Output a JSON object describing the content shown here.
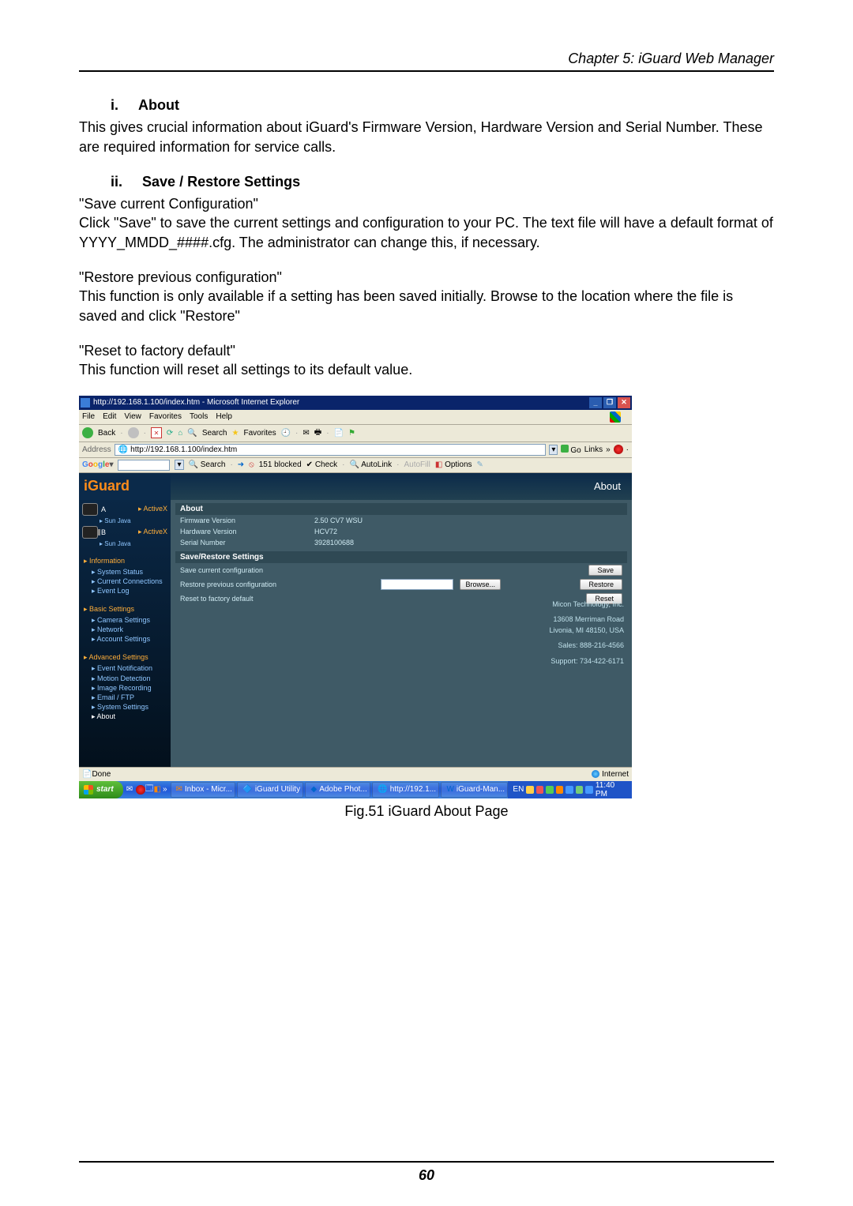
{
  "doc": {
    "chapter": "Chapter 5: iGuard Web Manager",
    "sec1_num": "i.",
    "sec1_title": "About",
    "sec1_p": "This gives crucial information about iGuard's Firmware Version, Hardware Version and Serial Number.    These are required information for service calls.",
    "sec2_num": "ii.",
    "sec2_title": "Save / Restore Settings",
    "sec2_l1": "\"Save current Configuration\"",
    "sec2_p1": "Click \"Save\" to save the current settings and configuration to your PC.    The text file will have a default format of YYYY_MMDD_####.cfg.    The administrator can change this, if necessary.",
    "sec2_l2": "\"Restore previous configuration\"",
    "sec2_p2": "This function is only available if a setting has been saved initially.    Browse to the location where the file is saved and click \"Restore\"",
    "sec2_l3": "\"Reset to factory default\"",
    "sec2_p3": "This function will reset all settings to its default value.",
    "caption": "Fig.51  iGuard About Page",
    "page_number": "60"
  },
  "shot": {
    "title": "http://192.168.1.100/index.htm - Microsoft Internet Explorer",
    "menu": {
      "file": "File",
      "edit": "Edit",
      "view": "View",
      "fav": "Favorites",
      "tools": "Tools",
      "help": "Help"
    },
    "toolbar": {
      "back": "Back",
      "search": "Search",
      "favorites": "Favorites"
    },
    "address_label": "Address",
    "address_value": "http://192.168.1.100/index.htm",
    "go": "Go",
    "links": "Links",
    "google": {
      "search": "Search",
      "blocked": "151 blocked",
      "check": "Check",
      "autolink": "AutoLink",
      "autofill": "AutoFill",
      "options": "Options"
    },
    "logo": "iGuard",
    "page_tab": "About",
    "sidebar": {
      "cam_a": "ActiveX",
      "cam_a_sub": "Sun Java",
      "cam_b": "ActiveX",
      "cam_b_sub": "Sun Java",
      "info_hdr": "Information",
      "info_items": [
        "System Status",
        "Current Connections",
        "Event Log"
      ],
      "basic_hdr": "Basic Settings",
      "basic_items": [
        "Camera Settings",
        "Network",
        "Account Settings"
      ],
      "adv_hdr": "Advanced Settings",
      "adv_items": [
        "Event Notification",
        "Motion Detection",
        "Image Recording",
        "Email / FTP",
        "System Settings",
        "About"
      ]
    },
    "about_panel": "About",
    "about_rows": {
      "fw_k": "Firmware Version",
      "fw_v": "2.50 CV7 WSU",
      "hw_k": "Hardware Version",
      "hw_v": "HCV72",
      "sn_k": "Serial Number",
      "sn_v": "3928100688"
    },
    "sr_panel": "Save/Restore Settings",
    "sr_rows": {
      "save_k": "Save current configuration",
      "save_btn": "Save",
      "restore_k": "Restore previous configuration",
      "browse_btn": "Browse...",
      "restore_btn": "Restore",
      "reset_k": "Reset to factory default",
      "reset_btn": "Reset"
    },
    "company": {
      "name": "Micon Technology, Inc.",
      "addr1": "13608 Merriman Road",
      "addr2": "Livonia, MI 48150, USA",
      "sales": "Sales: 888-216-4566",
      "support": "Support: 734-422-6171"
    },
    "status": {
      "done": "Done",
      "zone": "Internet"
    },
    "taskbar": {
      "start": "start",
      "lang": "EN",
      "tasks": [
        "Inbox - Micr...",
        "iGuard Utility",
        "Adobe Phot...",
        "http://192.1...",
        "iGuard-Man..."
      ],
      "time": "11:40 PM"
    }
  }
}
